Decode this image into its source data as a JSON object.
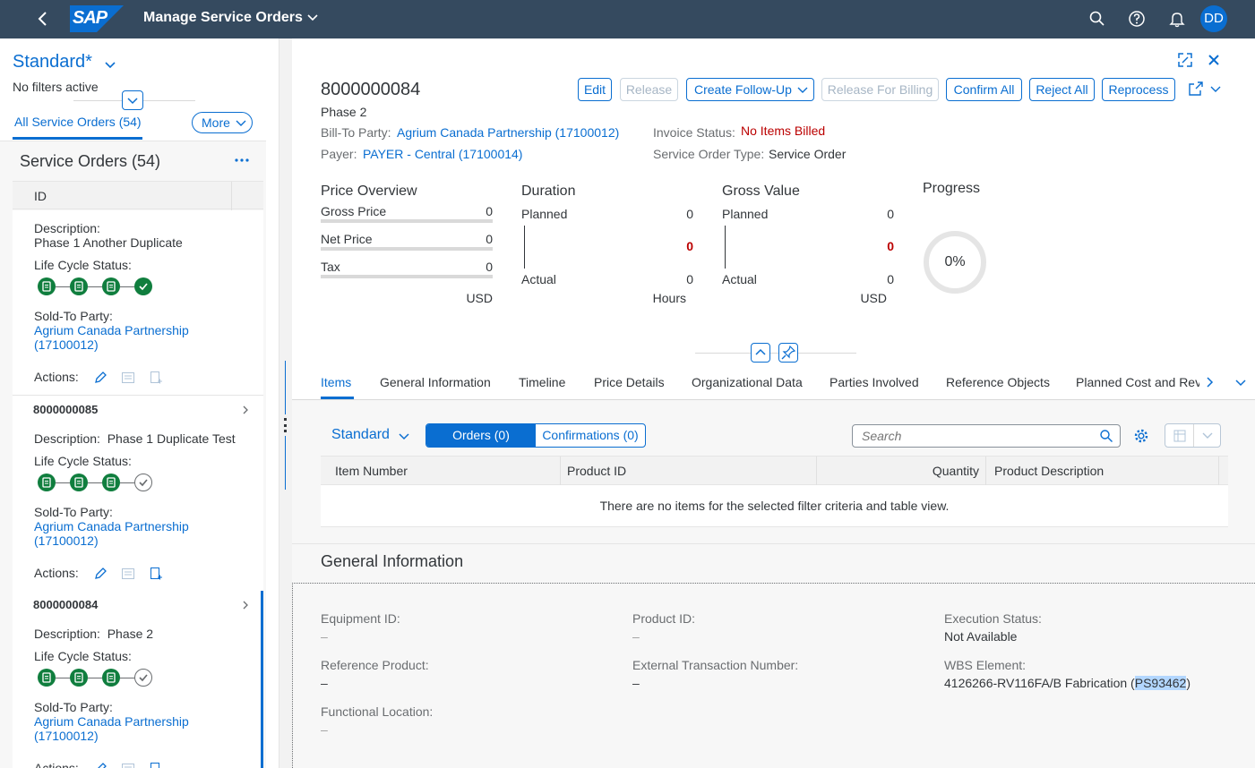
{
  "shell": {
    "app_title": "Manage Service Orders",
    "logo_text": "SAP",
    "avatar_initials": "DD"
  },
  "left": {
    "variant": "Standard*",
    "filter_status": "No filters active",
    "tab_all": "All Service Orders (54)",
    "more_label": "More",
    "list_title": "Service Orders (54)",
    "col_id": "ID",
    "items": [
      {
        "id": "",
        "desc_label": "Description:",
        "desc": "Phase 1 Another Duplicate",
        "lcs_label": "Life Cycle Status:",
        "lcs": [
          "done",
          "done",
          "done",
          "complete"
        ],
        "party_label": "Sold-To Party:",
        "party": "Agrium Canada Partnership (17100012)",
        "actions_label": "Actions:"
      },
      {
        "id": "8000000085",
        "desc_label": "Description:",
        "desc": "Phase 1 Duplicate Test",
        "lcs_label": "Life Cycle Status:",
        "lcs": [
          "done",
          "done",
          "done",
          "open"
        ],
        "party_label": "Sold-To Party:",
        "party": "Agrium Canada Partnership (17100012)",
        "actions_label": "Actions:"
      },
      {
        "id": "8000000084",
        "desc_label": "Description:",
        "desc": "Phase 2",
        "lcs_label": "Life Cycle Status:",
        "lcs": [
          "done",
          "done",
          "done",
          "open"
        ],
        "party_label": "Sold-To Party:",
        "party": "Agrium Canada Partnership (17100012)",
        "actions_label": "Actions:"
      }
    ]
  },
  "header": {
    "order_id": "8000000084",
    "subtitle": "Phase 2",
    "bill_to_label": "Bill-To Party:",
    "bill_to": "Agrium Canada Partnership (17100012)",
    "payer_label": "Payer:",
    "payer": "PAYER - Central (17100014)",
    "invoice_label": "Invoice Status:",
    "invoice_status": "No Items Billed",
    "type_label": "Service Order Type:",
    "type": "Service Order",
    "buttons": {
      "edit": "Edit",
      "release": "Release",
      "follow_up": "Create Follow-Up",
      "release_billing": "Release For Billing",
      "confirm_all": "Confirm All",
      "reject_all": "Reject All",
      "reprocess": "Reprocess"
    }
  },
  "kpi": {
    "price": {
      "title": "Price Overview",
      "rows": [
        {
          "label": "Gross Price",
          "value": "0"
        },
        {
          "label": "Net Price",
          "value": "0"
        },
        {
          "label": "Tax",
          "value": "0"
        }
      ],
      "unit": "USD"
    },
    "duration": {
      "title": "Duration",
      "planned_label": "Planned",
      "planned": "0",
      "diff": "0",
      "actual_label": "Actual",
      "actual": "0",
      "unit": "Hours"
    },
    "gross": {
      "title": "Gross Value",
      "planned_label": "Planned",
      "planned": "0",
      "diff": "0",
      "actual_label": "Actual",
      "actual": "0",
      "unit": "USD"
    },
    "progress": {
      "title": "Progress",
      "value_text": "0%",
      "percent": 0
    }
  },
  "tabs": [
    "Items",
    "General Information",
    "Timeline",
    "Price Details",
    "Organizational Data",
    "Parties Involved",
    "Reference Objects",
    "Planned Cost and Rev"
  ],
  "items_section": {
    "variant": "Standard",
    "seg_orders": "Orders (0)",
    "seg_confirmations": "Confirmations (0)",
    "search_placeholder": "Search",
    "columns": [
      "Item Number",
      "Product ID",
      "Quantity",
      "Product Description"
    ],
    "no_data": "There are no items for the selected filter criteria and table view."
  },
  "general": {
    "title": "General Information",
    "equipment_label": "Equipment ID:",
    "equipment": "–",
    "product_label": "Product ID:",
    "product": "–",
    "exec_label": "Execution Status:",
    "exec": "Not Available",
    "ref_product_label": "Reference Product:",
    "ref_product": "–",
    "ext_txn_label": "External Transaction Number:",
    "ext_txn": "–",
    "wbs_label": "WBS Element:",
    "wbs_text": "4126266-RV116FA/B Fabrication (",
    "wbs_highlight": "PS93462",
    "wbs_end": ")",
    "func_loc_label": "Functional Location:",
    "func_loc": "–"
  },
  "colors": {
    "shell": "#354a5f",
    "link": "#0a6ed1",
    "status_green": "#107e3e",
    "negative": "#bb0000"
  }
}
